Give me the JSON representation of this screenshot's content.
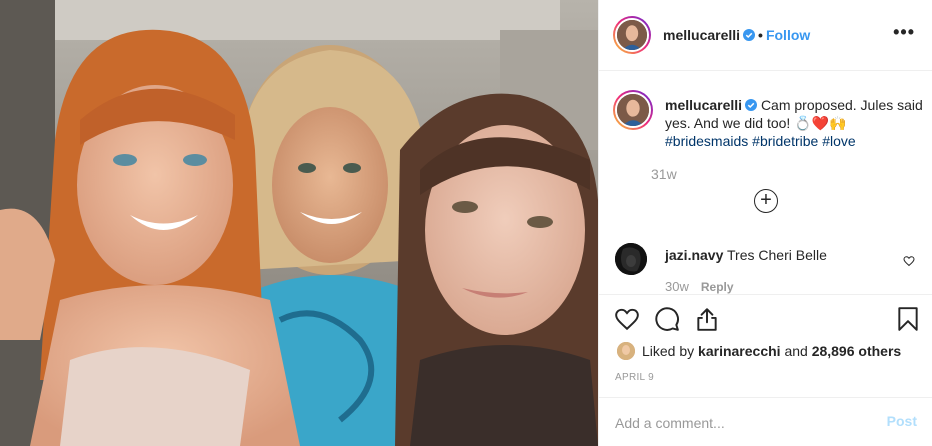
{
  "header": {
    "username": "mellucarelli",
    "separator": "•",
    "follow_label": "Follow",
    "more_label": "•••"
  },
  "caption": {
    "username": "mellucarelli",
    "text": "Cam proposed. Jules said yes. And we did too! 💍❤️🙌",
    "hashtags": [
      "#bridesmaids",
      "#bridetribe",
      "#love"
    ],
    "age": "31w",
    "load_more_label": "+"
  },
  "comment": {
    "username": "jazi.navy",
    "text": "Tres Cheri Belle",
    "age": "30w",
    "reply_label": "Reply"
  },
  "likes": {
    "prefix": "Liked by",
    "user": "karinarecchi",
    "and": "and",
    "others": "28,896 others"
  },
  "date": "April 9",
  "comment_box": {
    "placeholder": "Add a comment...",
    "post_label": "Post"
  },
  "icons": {
    "like": "heart-icon",
    "comment": "comment-icon",
    "share": "share-icon",
    "save": "bookmark-icon",
    "verified": "verified-badge-icon"
  },
  "colors": {
    "link": "#3897f0",
    "hashtag": "#003569",
    "muted": "#999999",
    "post_disabled": "#b2dffc"
  }
}
